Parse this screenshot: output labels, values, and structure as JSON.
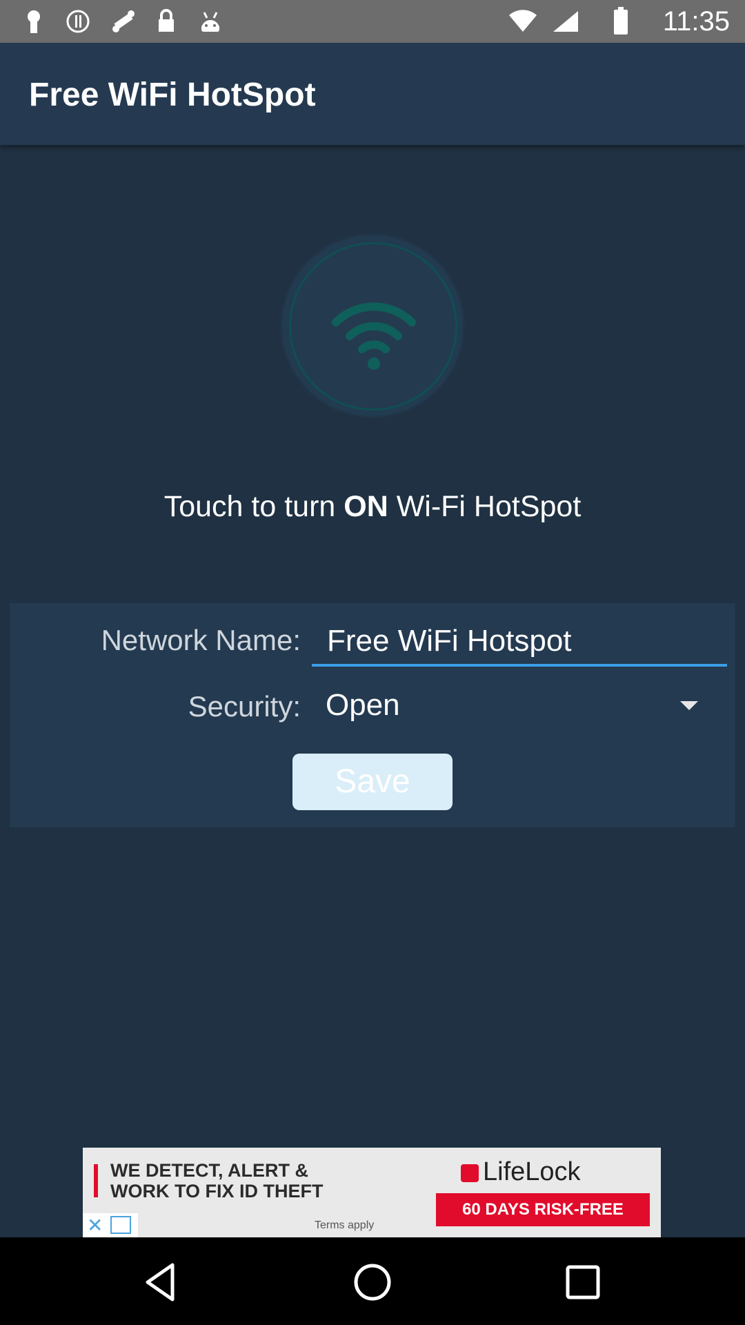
{
  "status_bar": {
    "time": "11:35",
    "left_icons": [
      "keyhole-icon",
      "info-icon",
      "fake-gps-icon",
      "lock-icon",
      "android-icon"
    ],
    "right_icons": [
      "wifi-signal-icon",
      "cell-signal-icon",
      "battery-icon"
    ]
  },
  "app_bar": {
    "title": "Free WiFi HotSpot"
  },
  "hotspot": {
    "icon": "wifi-icon",
    "prompt_prefix": "Touch to turn ",
    "prompt_bold": "ON",
    "prompt_suffix": " Wi-Fi HotSpot"
  },
  "form": {
    "network_label": "Network Name:",
    "network_value": "Free WiFi Hotspot",
    "security_label": "Security:",
    "security_value": "Open",
    "save_label": "Save"
  },
  "ad": {
    "headline": "WE DETECT, ALERT &\nWORK TO FIX ID THEFT",
    "brand": "LifeLock",
    "cta": "60 DAYS RISK-FREE",
    "terms": "Terms apply"
  },
  "nav": {
    "back": "back-icon",
    "home": "home-icon",
    "recents": "recents-icon"
  }
}
